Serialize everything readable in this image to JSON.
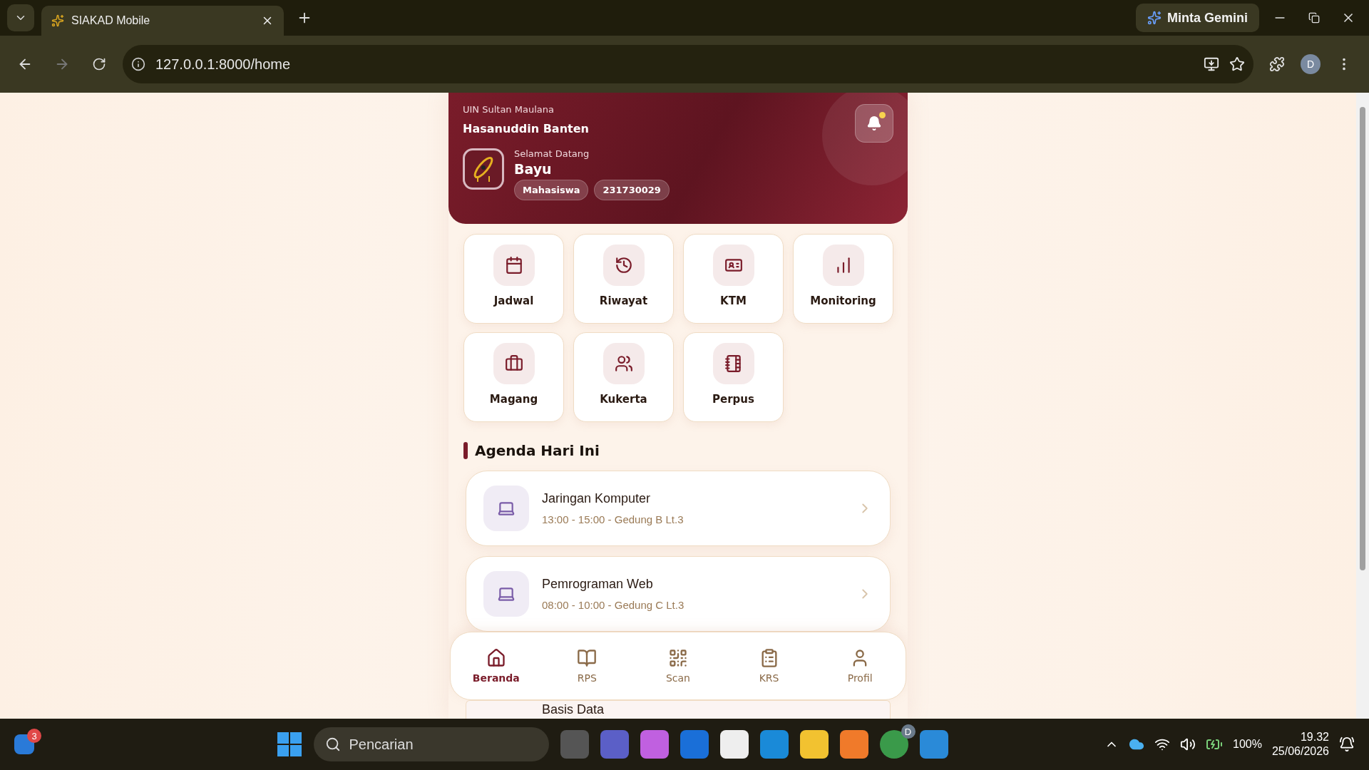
{
  "browser": {
    "tab_title": "SIAKAD Mobile",
    "gemini_button": "Minta Gemini",
    "url": "127.0.0.1:8000/home",
    "profile_initial": "D"
  },
  "header": {
    "institution_line_1": "UIN Sultan Maulana",
    "institution_line_2": "Hasanuddin Banten",
    "has_unread_notifications": true,
    "greeting": "Selamat Datang",
    "name": "Bayu",
    "badges": [
      "Mahasiswa",
      "231730029"
    ]
  },
  "menu": [
    {
      "label": "Jadwal"
    },
    {
      "label": "Riwayat"
    },
    {
      "label": "KTM"
    },
    {
      "label": "Monitoring"
    },
    {
      "label": "Magang"
    },
    {
      "label": "Kukerta"
    },
    {
      "label": "Perpus"
    }
  ],
  "agenda": {
    "title": "Agenda Hari Ini",
    "items": [
      {
        "title": "Jaringan Komputer",
        "detail": "13:00 - 15:00 - Gedung B Lt.3"
      },
      {
        "title": "Pemrograman Web",
        "detail": "08:00 - 10:00 - Gedung C Lt.3"
      },
      {
        "title": "Basis Data"
      }
    ]
  },
  "bottom_nav": [
    {
      "label": "Beranda",
      "selected": true
    },
    {
      "label": "RPS",
      "selected": false
    },
    {
      "label": "Scan",
      "selected": false
    },
    {
      "label": "KRS",
      "selected": false
    },
    {
      "label": "Profil",
      "selected": false
    }
  ],
  "taskbar": {
    "widget_badge": "3",
    "search_placeholder": "Pencarian",
    "chrome_badge": "D",
    "battery": "100%",
    "time": "19.32",
    "date": "25/06/2026"
  }
}
